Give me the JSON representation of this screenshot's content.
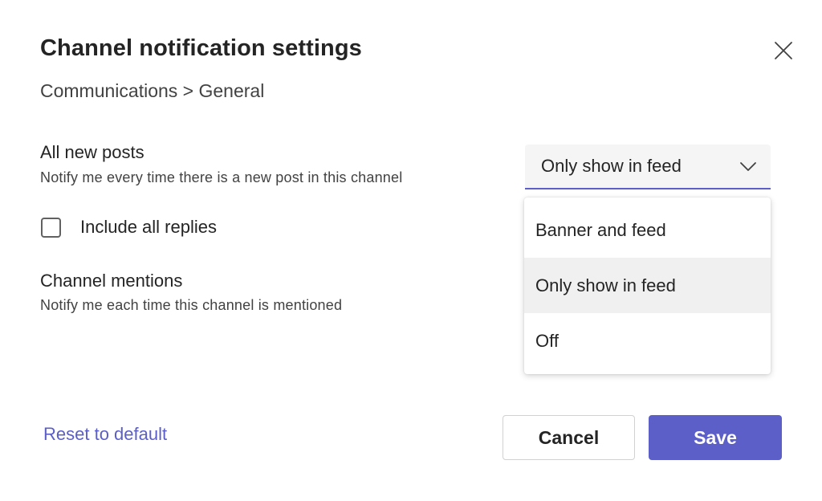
{
  "dialog": {
    "title": "Channel notification settings",
    "breadcrumb": "Communications > General",
    "close_icon": "close-icon"
  },
  "all_new_posts": {
    "title": "All new posts",
    "description": "Notify me every time there is a new post in this channel",
    "selected_value": "Only show in feed",
    "options": [
      "Banner and feed",
      "Only show in feed",
      "Off"
    ],
    "dropdown_icon": "chevron-down-icon"
  },
  "include_replies": {
    "label": "Include all replies",
    "checked": false
  },
  "channel_mentions": {
    "title": "Channel mentions",
    "description": "Notify me each time this channel is mentioned"
  },
  "footer": {
    "reset_label": "Reset to default",
    "cancel_label": "Cancel",
    "save_label": "Save"
  },
  "colors": {
    "accent": "#5b5fc7",
    "text": "#242424",
    "secondary_text": "#424242",
    "selected_option_bg": "#f0f0f0"
  }
}
